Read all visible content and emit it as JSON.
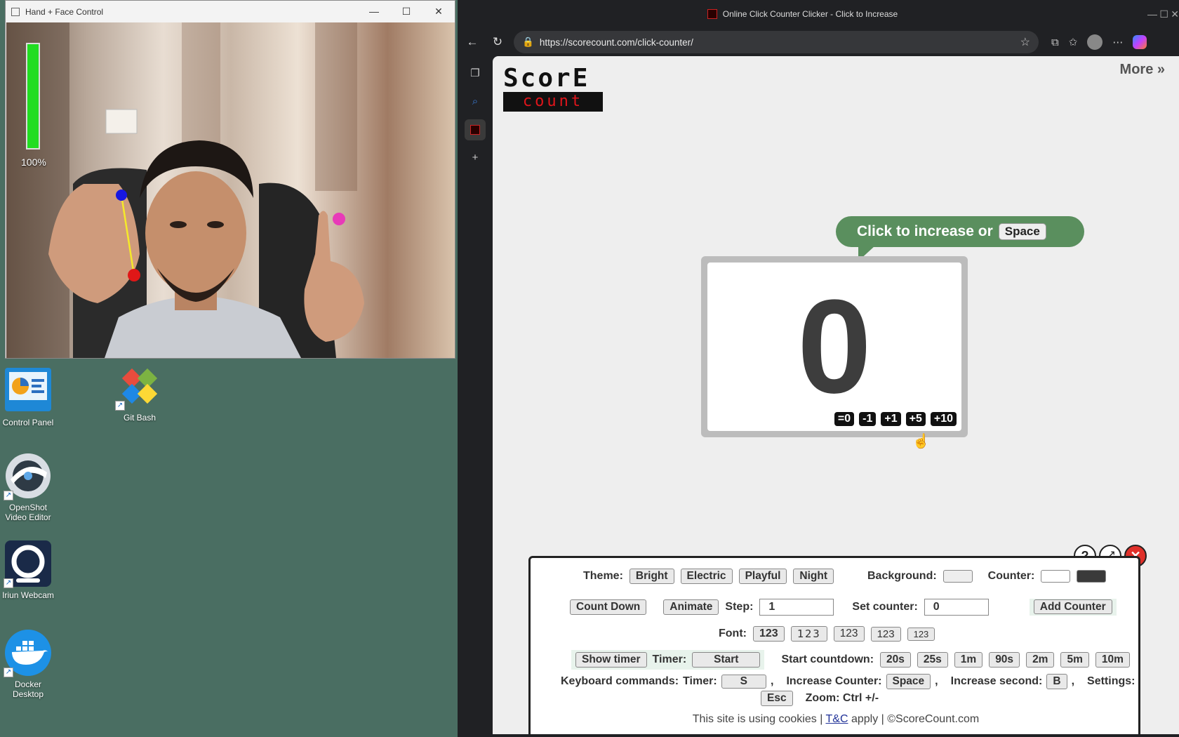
{
  "camera_window": {
    "title": "Hand + Face Control",
    "level_percent_label": "100%",
    "level_fraction": 1.0
  },
  "desktop": {
    "icons": [
      {
        "label": "Control Panel"
      },
      {
        "label": "Git Bash"
      },
      {
        "label": "OpenShot Video Editor"
      },
      {
        "label": "Iriun Webcam"
      },
      {
        "label": "Docker Desktop"
      }
    ]
  },
  "browser": {
    "tab_title": "Online Click Counter Clicker - Click to Increase",
    "url": "https://scorecount.com/click-counter/"
  },
  "page": {
    "logo_top": "ScorE",
    "logo_bottom": "count",
    "more_link": "More »",
    "bubble_text": "Click to increase or",
    "bubble_key": "Space",
    "counter_value": "0",
    "quick_buttons": [
      "=0",
      "-1",
      "+1",
      "+5",
      "+10"
    ],
    "panel": {
      "theme_label": "Theme:",
      "themes": [
        "Bright",
        "Electric",
        "Playful",
        "Night"
      ],
      "background_label": "Background:",
      "counter_label": "Counter:",
      "count_down": "Count Down",
      "animate": "Animate",
      "step_label": "Step:",
      "step_value": "1",
      "set_counter_label": "Set counter:",
      "set_counter_value": "0",
      "add_counter": "Add Counter",
      "font_label": "Font:",
      "font_options": [
        "123",
        "123",
        "123",
        "123",
        "123"
      ],
      "show_timer": "Show timer",
      "timer_label": "Timer:",
      "start": "Start",
      "start_countdown_label": "Start countdown:",
      "countdown_options": [
        "20s",
        "25s",
        "1m",
        "90s",
        "2m",
        "5m",
        "10m"
      ],
      "keyboard_label": "Keyboard commands:",
      "kb_timer_label": "Timer:",
      "kb_timer_key": "S",
      "kb_increase_label": "Increase Counter:",
      "kb_increase_key": "Space",
      "kb_second_label": "Increase second:",
      "kb_second_key": "B",
      "kb_settings_label": "Settings:",
      "kb_settings_key": "Esc",
      "zoom_text": "Zoom: Ctrl +/-"
    },
    "footer_pre": "This site is using cookies |",
    "footer_link": "T&C",
    "footer_post": "apply | ©ScoreCount.com"
  },
  "colors": {
    "desktop_bg": "#4a6e62",
    "bubble": "#5a8f5e",
    "close_red": "#e0302a",
    "level_green": "#22dd22"
  }
}
